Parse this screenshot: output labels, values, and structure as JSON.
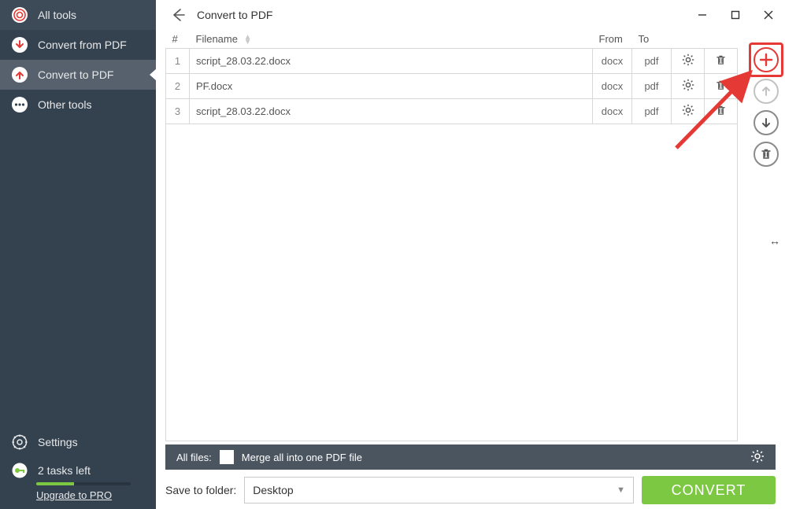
{
  "sidebar": {
    "items": [
      {
        "label": "All tools"
      },
      {
        "label": "Convert from PDF"
      },
      {
        "label": "Convert to PDF"
      },
      {
        "label": "Other tools"
      }
    ],
    "settings_label": "Settings",
    "tasks_label": "2 tasks left",
    "upgrade_label": "Upgrade to PRO"
  },
  "header": {
    "title": "Convert to PDF"
  },
  "table": {
    "headers": {
      "num": "#",
      "filename": "Filename",
      "from": "From",
      "to": "To"
    },
    "rows": [
      {
        "num": "1",
        "filename": "script_28.03.22.docx",
        "from": "docx",
        "to": "pdf"
      },
      {
        "num": "2",
        "filename": "PF.docx",
        "from": "docx",
        "to": "pdf"
      },
      {
        "num": "3",
        "filename": "script_28.03.22.docx",
        "from": "docx",
        "to": "pdf"
      }
    ]
  },
  "merge_bar": {
    "all_label": "All files:",
    "merge_label": "Merge all into one PDF file"
  },
  "bottom": {
    "save_label": "Save to folder:",
    "folder": "Desktop",
    "convert_label": "CONVERT"
  }
}
